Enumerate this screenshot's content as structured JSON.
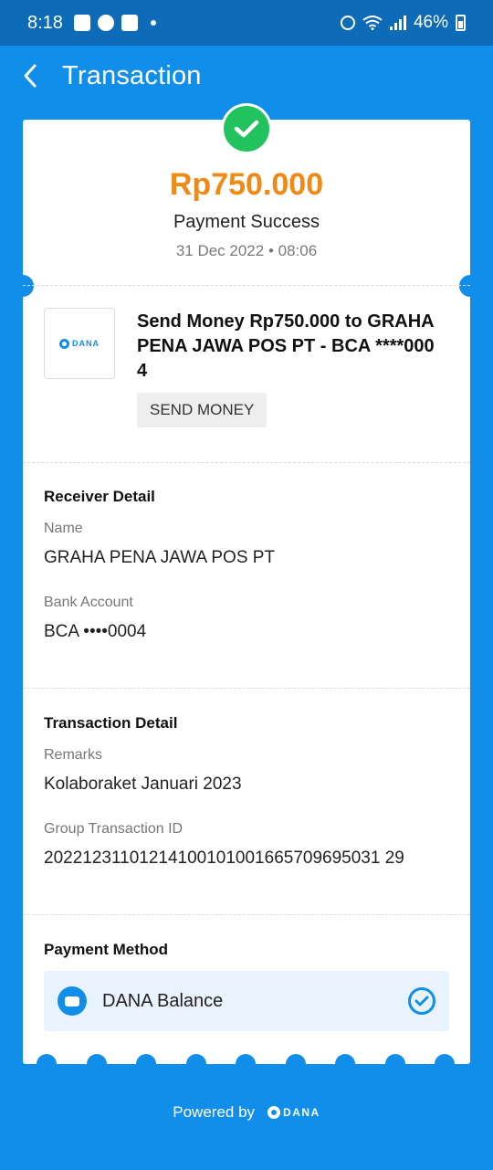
{
  "status_bar": {
    "time": "8:18",
    "battery": "46%"
  },
  "header": {
    "title": "Transaction"
  },
  "summary": {
    "amount": "Rp750.000",
    "status": "Payment Success",
    "datetime": "31 Dec 2022 • 08:06"
  },
  "transaction": {
    "logo_text": "DANA",
    "title": "Send Money Rp750.000 to GRAHA PENA JAWA POS PT - BCA ****0004",
    "tag": "SEND MONEY"
  },
  "receiver": {
    "section_title": "Receiver Detail",
    "name_label": "Name",
    "name_value": "GRAHA PENA JAWA POS PT",
    "account_label": "Bank Account",
    "account_value": "BCA ••••0004"
  },
  "details": {
    "section_title": "Transaction Detail",
    "remarks_label": "Remarks",
    "remarks_value": "Kolaboraket Januari 2023",
    "group_id_label": "Group Transaction ID",
    "group_id_value": "20221231101214100101001665709695031 29"
  },
  "payment": {
    "section_title": "Payment Method",
    "method": "DANA Balance"
  },
  "footer": {
    "powered_by": "Powered by",
    "brand": "DANA"
  },
  "colors": {
    "brand_blue": "#118ee9",
    "success_green": "#22c35e",
    "amount_orange": "#f08a14"
  },
  "icons": [
    "back-arrow-icon",
    "checkmark-icon",
    "dana-logo-icon",
    "wallet-icon",
    "selected-check-icon"
  ]
}
